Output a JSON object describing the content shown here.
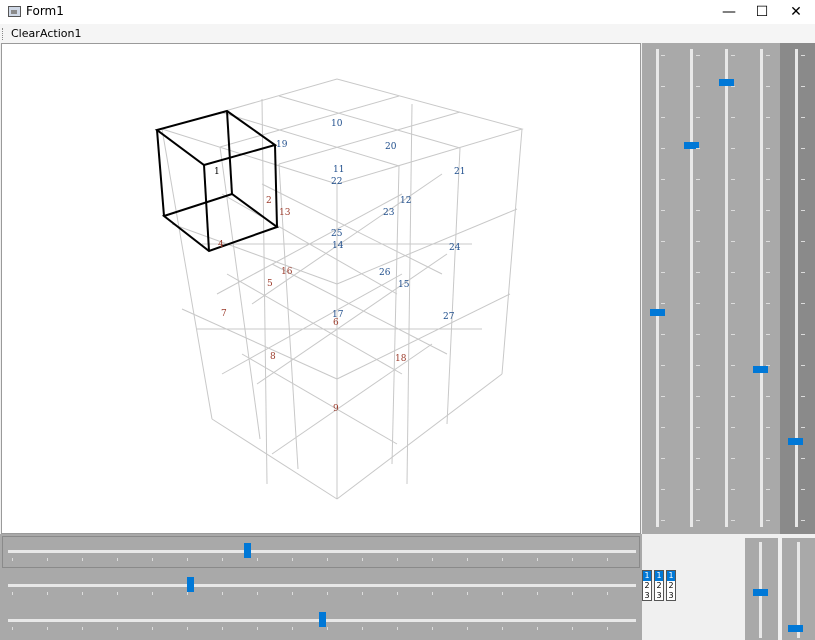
{
  "window": {
    "title": "Form1",
    "minimize_label": "—",
    "maximize_label": "☐",
    "close_label": "✕"
  },
  "menu": {
    "items": [
      {
        "label": "Clear"
      },
      {
        "label": "Action1"
      }
    ]
  },
  "cube_labels": {
    "blue": [
      "10",
      "19",
      "20",
      "21",
      "11",
      "22",
      "12",
      "23",
      "24",
      "25",
      "14",
      "26",
      "15",
      "27",
      "17"
    ],
    "red": [
      "1",
      "2",
      "4",
      "13",
      "16",
      "5",
      "7",
      "6",
      "8",
      "18",
      "9"
    ]
  },
  "mini_boxes": [
    {
      "top": "1",
      "mid": "2",
      "bot": "3"
    },
    {
      "top": "1",
      "mid": "2",
      "bot": "3"
    },
    {
      "top": "1",
      "mid": "2",
      "bot": "3"
    }
  ],
  "sliders": {
    "vertical": [
      {
        "name": "v1",
        "value": 0.55
      },
      {
        "name": "v2",
        "value": 0.2
      },
      {
        "name": "v3",
        "value": 0.07
      },
      {
        "name": "v4",
        "value": 0.67
      },
      {
        "name": "v5",
        "value": 0.82
      }
    ],
    "horizontal": [
      {
        "name": "h1",
        "value": 0.38
      },
      {
        "name": "h2",
        "value": 0.29
      },
      {
        "name": "h3",
        "value": 0.5
      }
    ]
  },
  "colors": {
    "accent": "#0078d7",
    "panel": "#a9a9a9",
    "panel_dark": "#8a8a8a",
    "label_blue": "#1f4e8c",
    "label_red": "#9b3a2a"
  }
}
